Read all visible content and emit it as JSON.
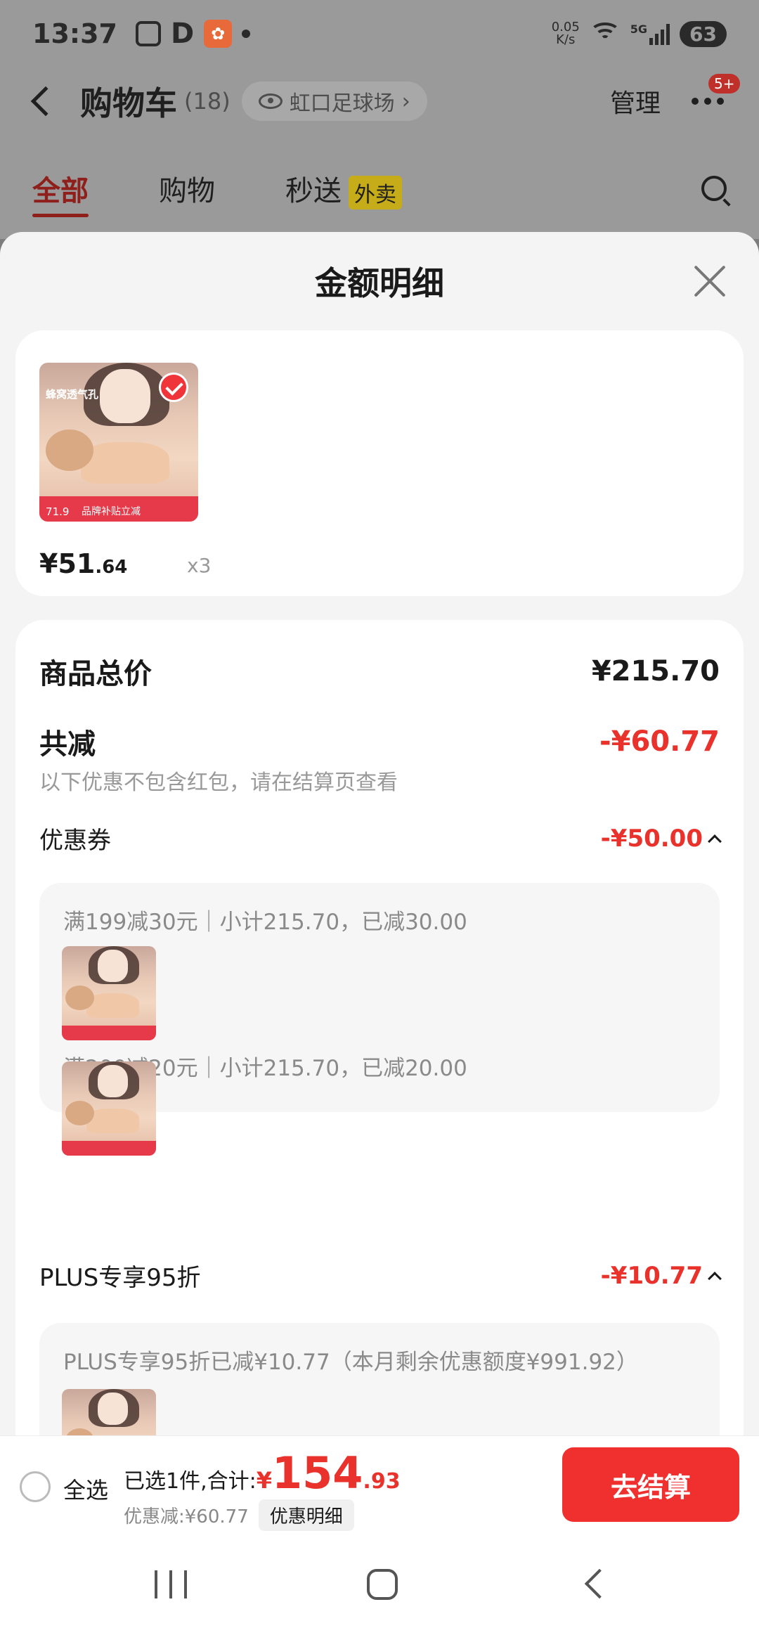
{
  "status_bar": {
    "time": "13:37",
    "d_label": "D",
    "net_speed_value": "0.05",
    "net_speed_unit": "K/s",
    "network_type": "5G",
    "battery": "63"
  },
  "nav": {
    "title": "购物车",
    "count": "(18)",
    "location": "虹口足球场",
    "location_chevron": "›",
    "manage": "管理",
    "more_badge": "5+"
  },
  "tabs": [
    {
      "label": "全部",
      "active": true
    },
    {
      "label": "购物"
    },
    {
      "label": "秒送",
      "badge": "外卖"
    }
  ],
  "sheet": {
    "title": "金额明细",
    "product": {
      "thumb_text": "蜂窝透气孔",
      "thumb_band_text": "品牌补贴立减",
      "thumb_price": "71.9",
      "price_prefix": "¥51",
      "price_decimal": ".64",
      "qty": "x3"
    },
    "total_label": "商品总价",
    "total_value": "¥215.70",
    "reduce_label": "共减",
    "reduce_value": "-¥60.77",
    "reduce_note": "以下优惠不包含红包，请在结算页查看",
    "coupon_label": "优惠券",
    "coupon_value": "-¥50.00",
    "coupon_rules": [
      "满199减30元｜小计215.70，已减30.00",
      "满200减20元｜小计215.70，已减20.00"
    ],
    "plus_label": "PLUS专享95折",
    "plus_value": "-¥10.77",
    "plus_rule": "PLUS专享95折已减¥10.77（本月剩余优惠额度¥991.92）"
  },
  "bottom_bar": {
    "select_all": "全选",
    "selected_text": "已选1件,合计:",
    "total_yen": "¥",
    "total_int": "154",
    "total_dec": ".93",
    "discount_text": "优惠减:¥60.77",
    "detail_chip": "优惠明细",
    "checkout": "去结算"
  },
  "colors": {
    "accent_red": "#e8322b",
    "checkout_red": "#f02f2f",
    "badge_yellow": "#c6ac18"
  }
}
